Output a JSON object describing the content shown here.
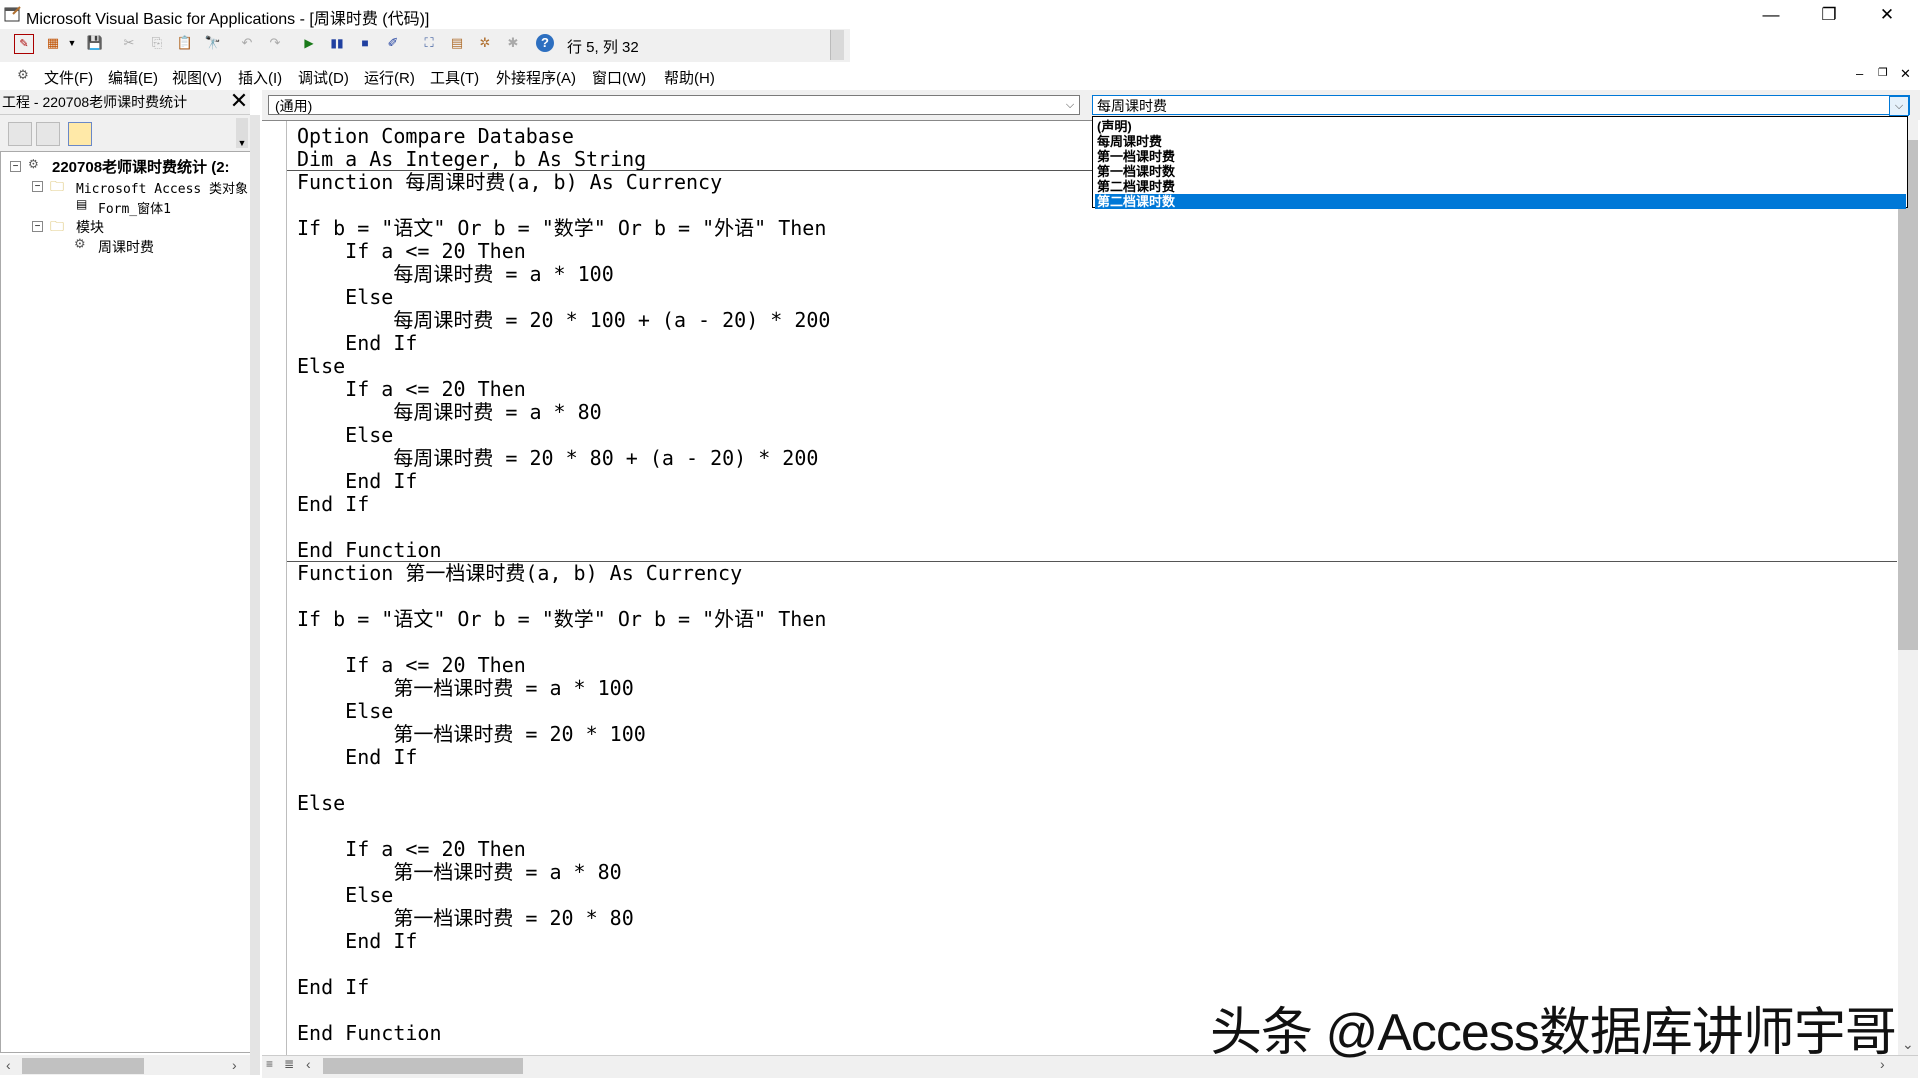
{
  "window": {
    "title": "Microsoft Visual Basic for Applications - [周课时费 (代码)]",
    "minimize": "—",
    "restore": "❐",
    "close": "✕"
  },
  "toolbar": {
    "cursor_position": "行 5, 列 32"
  },
  "menu": [
    "文件(F)",
    "编辑(E)",
    "视图(V)",
    "插入(I)",
    "调试(D)",
    "运行(R)",
    "工具(T)",
    "外接程序(A)",
    "窗口(W)",
    "帮助(H)"
  ],
  "project": {
    "title": "工程 - 220708老师课时费统计",
    "close": "✕",
    "tree": {
      "root": "220708老师课时费统计 (2:",
      "access_objects": "Microsoft Access 类对象",
      "form": "Form_窗体1",
      "modules": "模块",
      "module_item": "周课时费"
    }
  },
  "code_window": {
    "object_combo": "(通用)",
    "proc_combo": "每周课时费",
    "dropdown_items": [
      "(声明)",
      "每周课时费",
      "第一档课时费",
      "第一档课时数",
      "第二档课时费",
      "第二档课时数"
    ],
    "dropdown_selected": "第二档课时数",
    "lines": [
      "Option Compare Database",
      "Dim a As Integer, b As String",
      "Function 每周课时费(a, b) As Currency",
      "",
      "If b = \"语文\" Or b = \"数学\" Or b = \"外语\" Then",
      "    If a <= 20 Then",
      "        每周课时费 = a * 100",
      "    Else",
      "        每周课时费 = 20 * 100 + (a - 20) * 200",
      "    End If",
      "Else",
      "    If a <= 20 Then",
      "        每周课时费 = a * 80",
      "    Else",
      "        每周课时费 = 20 * 80 + (a - 20) * 200",
      "    End If",
      "End If",
      "",
      "End Function",
      "Function 第一档课时费(a, b) As Currency",
      "",
      "If b = \"语文\" Or b = \"数学\" Or b = \"外语\" Then",
      "",
      "    If a <= 20 Then",
      "        第一档课时费 = a * 100",
      "    Else",
      "        第一档课时费 = 20 * 100",
      "    End If",
      "",
      "Else",
      "",
      "    If a <= 20 Then",
      "        第一档课时费 = a * 80",
      "    Else",
      "        第一档课时费 = 20 * 80",
      "    End If",
      "",
      "End If",
      "",
      "End Function"
    ]
  },
  "watermark": "头条 @Access数据库讲师宇哥"
}
